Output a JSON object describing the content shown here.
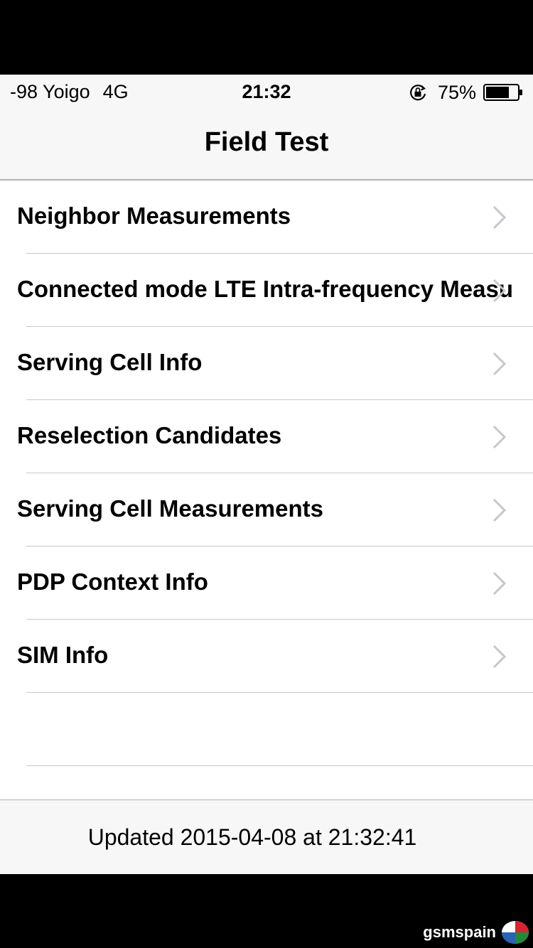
{
  "status_bar": {
    "carrier": "-98 Yoigo",
    "network": "4G",
    "time": "21:32",
    "battery_percent": "75%",
    "battery_level": 0.75
  },
  "nav": {
    "title": "Field Test"
  },
  "list": {
    "items": [
      {
        "label": "Neighbor Measurements"
      },
      {
        "label": "Connected mode LTE Intra-frequency Measu"
      },
      {
        "label": "Serving Cell Info"
      },
      {
        "label": "Reselection Candidates"
      },
      {
        "label": "Serving Cell Measurements"
      },
      {
        "label": "PDP Context Info"
      },
      {
        "label": "SIM Info"
      }
    ]
  },
  "footer": {
    "updated": "Updated 2015-04-08 at 21:32:41"
  },
  "watermark": {
    "text": "gsmspain"
  },
  "icons": {
    "chevron": "chevron-right-icon",
    "lock": "orientation-lock-icon",
    "battery": "battery-icon"
  },
  "colors": {
    "separator": "#c8c7cc",
    "chevron": "#c7c7cc",
    "bar_background": "#f7f7f7"
  }
}
